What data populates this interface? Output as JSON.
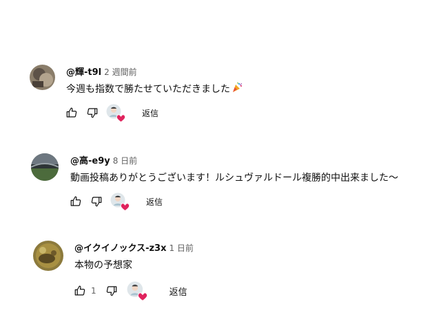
{
  "comments": [
    {
      "author": "@輝-t9l",
      "time": "2 週間前",
      "text": "今週も指数で勝たせていただきました",
      "emoji": "party-popper-icon",
      "likes": "",
      "reply_label": "返信"
    },
    {
      "author": "@高-e9y",
      "time": "8 日前",
      "text": "動画投稿ありがとうございます！ルシュヴァルドール複勝的中出来ました〜",
      "likes": "",
      "reply_label": "返信"
    },
    {
      "author": "@イクイノックス-z3x",
      "time": "1 日前",
      "text": "本物の予想家",
      "likes": "1",
      "reply_label": "返信"
    }
  ],
  "colors": {
    "heart": "#e0245e",
    "text": "#0f0f0f",
    "secondary": "#606060"
  }
}
